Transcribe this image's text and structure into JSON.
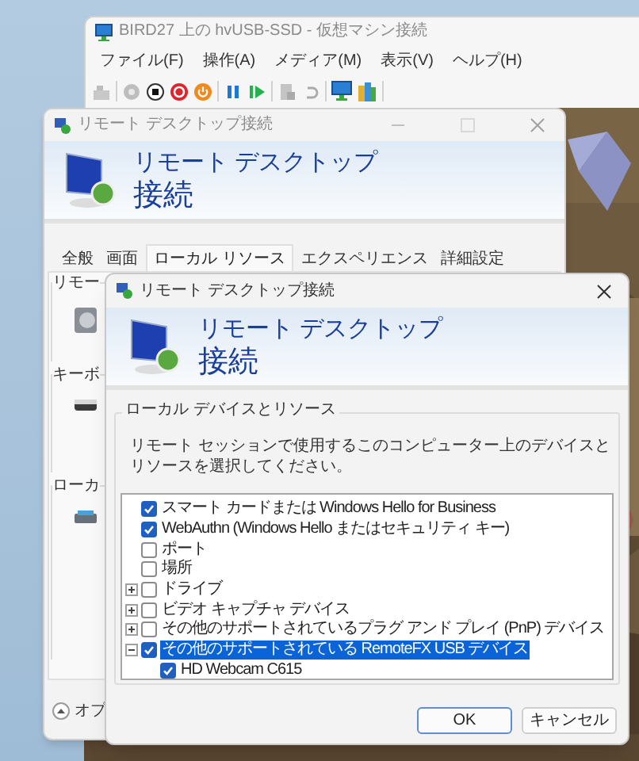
{
  "vm_window": {
    "title": "BIRD27 上の hvUSB-SSD - 仮想マシン接続",
    "menu": [
      "ファイル(F)",
      "操作(A)",
      "メディア(M)",
      "表示(V)",
      "ヘルプ(H)"
    ]
  },
  "back_window": {
    "title": "リモート デスクトップ接続",
    "banner": [
      "リモート デスクトップ",
      "接続"
    ],
    "tabs": [
      {
        "label": "全般",
        "selected": false
      },
      {
        "label": "画面",
        "selected": false
      },
      {
        "label": "ローカル リソース",
        "selected": true
      },
      {
        "label": "エクスペリエンス",
        "selected": false
      },
      {
        "label": "詳細設定",
        "selected": false
      }
    ],
    "groups": [
      "リモー",
      "キーボ",
      "ローカ"
    ],
    "options_toggle": "オプ"
  },
  "dialog": {
    "title": "リモート デスクトップ接続",
    "banner": [
      "リモート デスクトップ",
      "接続"
    ],
    "group_title": "ローカル デバイスとリソース",
    "description": "リモート セッションで使用するこのコンピューター上のデバイスとリソースを選択してください。",
    "devices": [
      {
        "kind": "item",
        "label": "スマート カードまたは Windows Hello for Business",
        "checked": true,
        "selected": false
      },
      {
        "kind": "item",
        "label": "WebAuthn (Windows Hello またはセキュリティ キー)",
        "checked": true,
        "selected": false
      },
      {
        "kind": "item",
        "label": "ポート",
        "checked": false,
        "selected": false
      },
      {
        "kind": "item",
        "label": "場所",
        "checked": false,
        "selected": false
      },
      {
        "kind": "group",
        "label": "ドライブ",
        "checked": false,
        "selected": false,
        "expanded": false
      },
      {
        "kind": "group",
        "label": "ビデオ キャプチャ デバイス",
        "checked": false,
        "selected": false,
        "expanded": false
      },
      {
        "kind": "group",
        "label": "その他のサポートされているプラグ アンド プレイ (PnP) デバイス",
        "checked": false,
        "selected": false,
        "expanded": false
      },
      {
        "kind": "group",
        "label": "その他のサポートされている RemoteFX USB デバイス",
        "checked": true,
        "selected": true,
        "expanded": true,
        "children": [
          {
            "kind": "item",
            "label": "HD Webcam C615",
            "checked": true,
            "selected": false
          }
        ]
      }
    ],
    "buttons": [
      {
        "label": "OK",
        "default": true
      },
      {
        "label": "キャンセル",
        "default": false
      }
    ]
  }
}
